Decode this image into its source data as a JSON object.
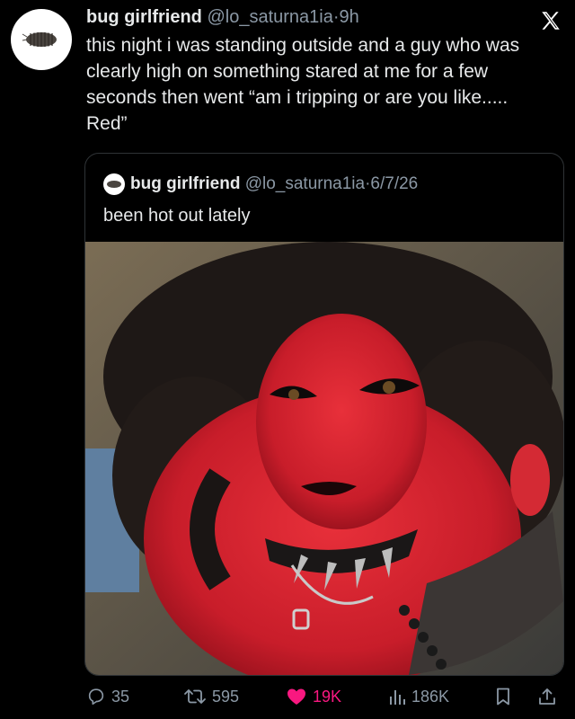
{
  "author": {
    "name": "bug girlfriend",
    "handle": "@lo_saturna1ia",
    "separator": "·",
    "time": "9h"
  },
  "tweet": {
    "text": "this night i was standing outside and a guy who was clearly high on something stared at me for a few seconds then went “am i tripping or are you like..... Red”"
  },
  "quoted_tweet": {
    "name": "bug girlfriend",
    "handle": "@lo_saturna1ia",
    "separator": "·",
    "date": "6/7/26",
    "text": "been hot out lately"
  },
  "actions": {
    "replies": "35",
    "reposts": "595",
    "likes": "19K",
    "views": "186K"
  },
  "colors": {
    "background": "#000000",
    "text": "#e7e9ea",
    "muted": "#8b98a5",
    "like": "#f91880"
  },
  "icons": [
    "x-logo-icon",
    "reply-icon",
    "repost-icon",
    "heart-icon",
    "views-icon",
    "bookmark-icon",
    "share-icon"
  ]
}
